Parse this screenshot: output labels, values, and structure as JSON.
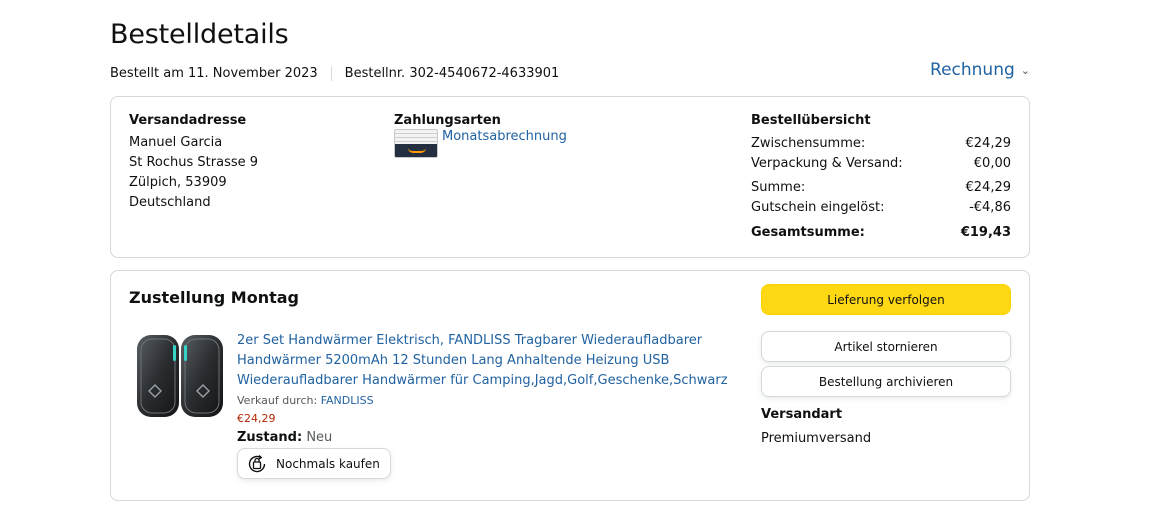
{
  "header": {
    "title": "Bestelldetails",
    "ordered_on": "Bestellt am 11. November 2023",
    "order_number": "Bestellnr. 302-4540672-4633901",
    "invoice_label": "Rechnung"
  },
  "shipping_address": {
    "title": "Versandadresse",
    "name": "Manuel Garcia",
    "street": "St Rochus Strasse 9",
    "city": "Zülpich, 53909",
    "country": "Deutschland"
  },
  "payment": {
    "title": "Zahlungsarten",
    "method": "Monatsabrechnung"
  },
  "summary": {
    "title": "Bestellübersicht",
    "subtotal_label": "Zwischensumme:",
    "subtotal": "€24,29",
    "shipping_label": "Verpackung & Versand:",
    "shipping": "€0,00",
    "sum_label": "Summe:",
    "sum": "€24,29",
    "voucher_label": "Gutschein eingelöst:",
    "voucher": "-€4,86",
    "total_label": "Gesamtsumme:",
    "total": "€19,43"
  },
  "delivery": {
    "title": "Zustellung Montag",
    "product_title": "2er Set Handwärmer Elektrisch, FANDLISS Tragbarer Wiederaufladbarer Handwärmer 5200mAh 12 Stunden Lang Anhaltende Heizung USB Wiederaufladbarer Handwärmer für Camping,Jagd,Golf,Geschenke,Schwarz",
    "seller_prefix": "Verkauf durch: ",
    "seller": "FANDLISS",
    "price": "€24,29",
    "condition_label": "Zustand:",
    "condition": "Neu",
    "buy_again_label": "Nochmals kaufen",
    "track_label": "Lieferung verfolgen",
    "cancel_label": "Artikel stornieren",
    "archive_label": "Bestellung archivieren",
    "ship_method_title": "Versandart",
    "ship_method": "Premiumversand"
  },
  "colors": {
    "link": "#2162a1",
    "price": "#b12704",
    "primary_button": "#ffd814",
    "border": "#d5d9d9"
  },
  "icons": [
    "chevron-down-icon",
    "amazon-card-icon",
    "buy-again-icon"
  ]
}
